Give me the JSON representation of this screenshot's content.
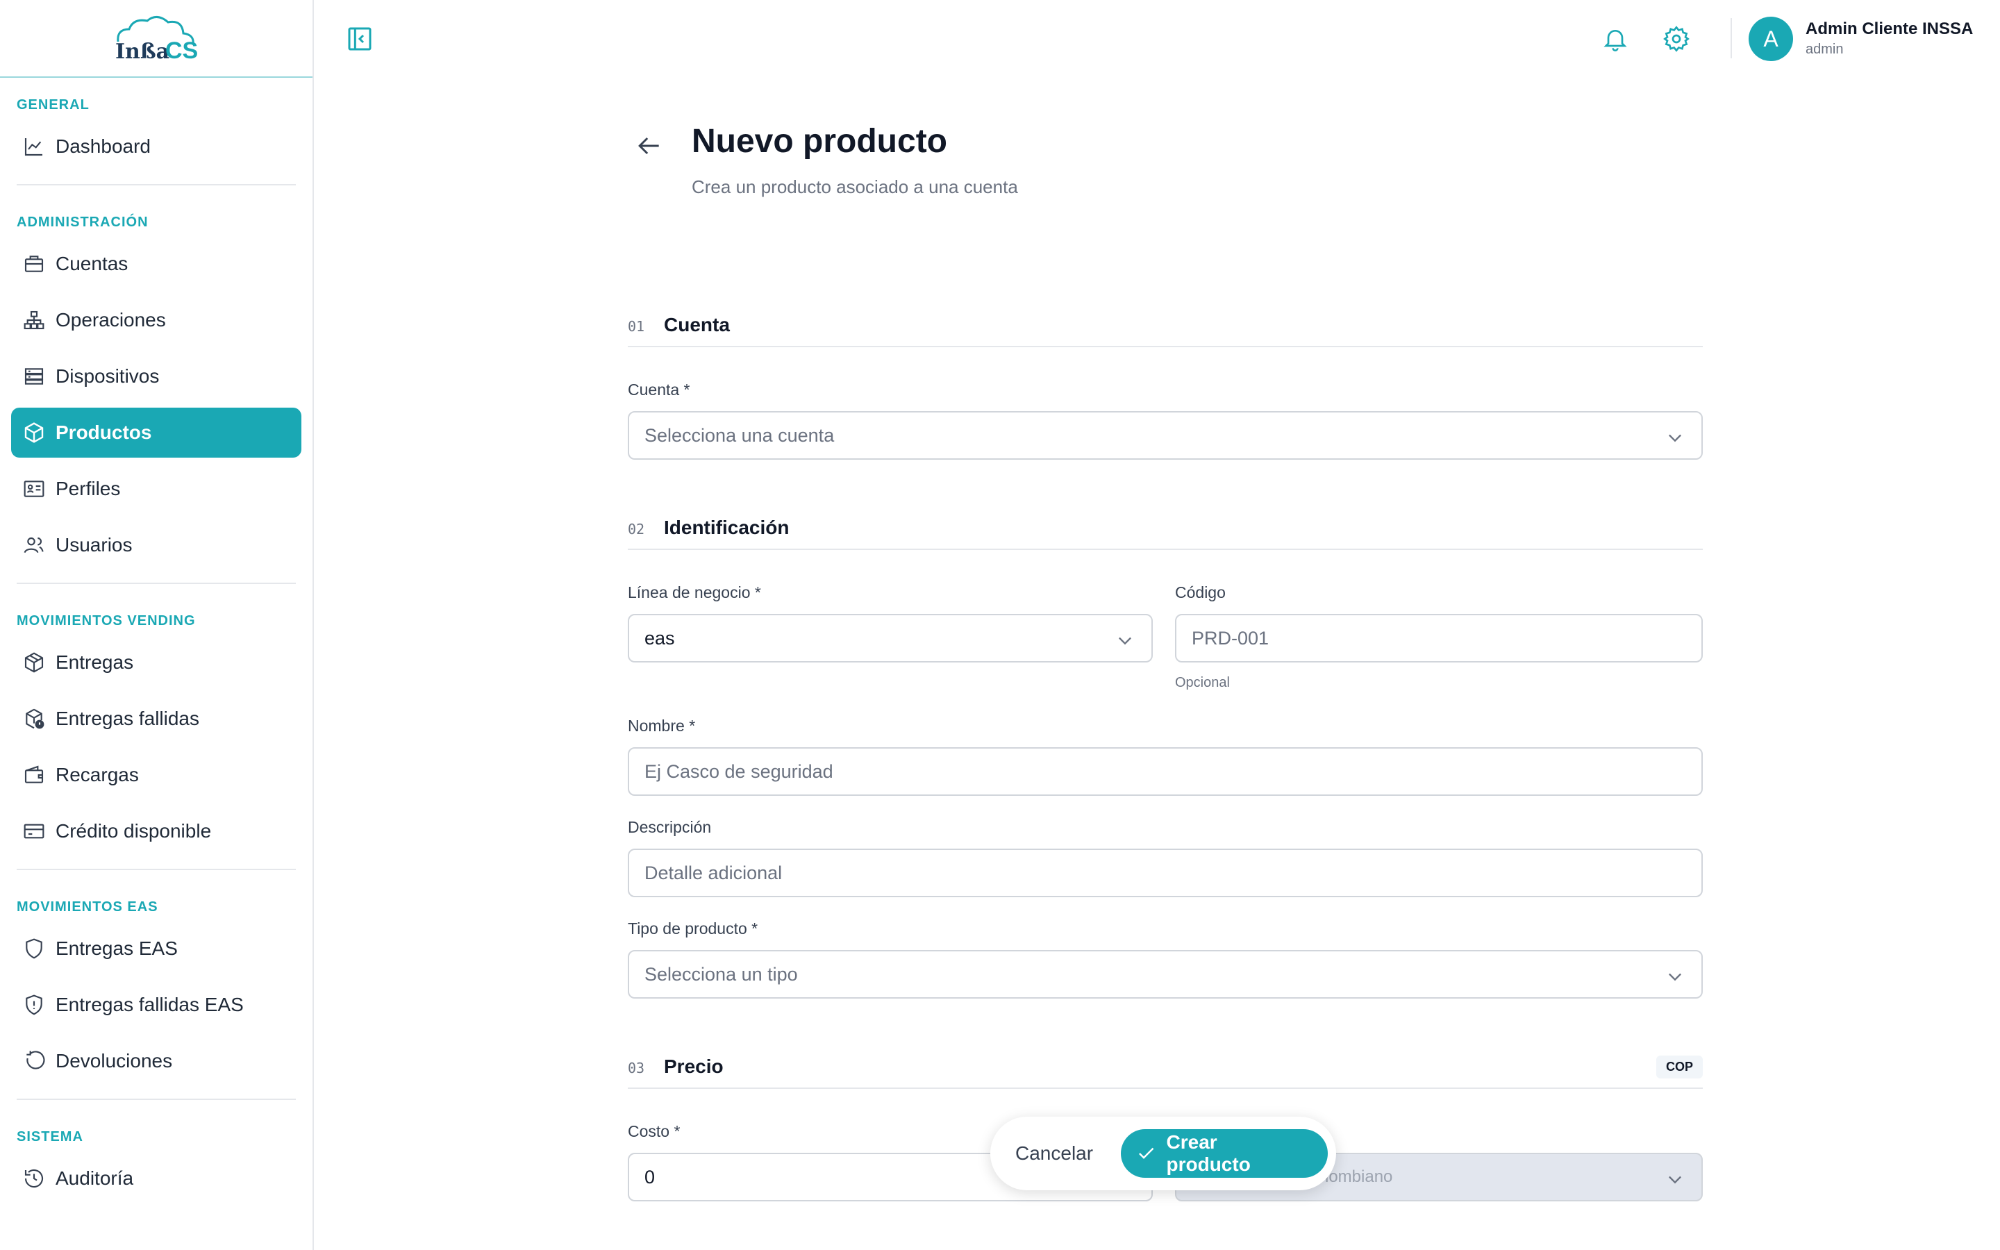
{
  "brand": {
    "logo_text": "Inssa CS",
    "accent": "#1aa8b4"
  },
  "sidebar": {
    "sections": [
      {
        "label": "GENERAL",
        "items": [
          {
            "label": "Dashboard",
            "icon": "chart-line-icon"
          }
        ]
      },
      {
        "label": "ADMINISTRACIÓN",
        "items": [
          {
            "label": "Cuentas",
            "icon": "briefcase-icon"
          },
          {
            "label": "Operaciones",
            "icon": "hierarchy-icon"
          },
          {
            "label": "Dispositivos",
            "icon": "server-icon"
          },
          {
            "label": "Productos",
            "icon": "box-icon",
            "active": true
          },
          {
            "label": "Perfiles",
            "icon": "id-card-icon"
          },
          {
            "label": "Usuarios",
            "icon": "users-icon"
          }
        ]
      },
      {
        "label": "MOVIMIENTOS VENDING",
        "items": [
          {
            "label": "Entregas",
            "icon": "package-icon"
          },
          {
            "label": "Entregas fallidas",
            "icon": "package-alert-icon"
          },
          {
            "label": "Recargas",
            "icon": "wallet-icon"
          },
          {
            "label": "Crédito disponible",
            "icon": "credit-card-icon"
          }
        ]
      },
      {
        "label": "MOVIMIENTOS EAS",
        "items": [
          {
            "label": "Entregas EAS",
            "icon": "shield-icon"
          },
          {
            "label": "Entregas fallidas EAS",
            "icon": "shield-alert-icon"
          },
          {
            "label": "Devoluciones",
            "icon": "undo-icon"
          }
        ]
      },
      {
        "label": "SISTEMA",
        "items": [
          {
            "label": "Auditoría",
            "icon": "history-icon"
          }
        ]
      }
    ]
  },
  "topbar": {
    "user": {
      "initial": "A",
      "name": "Admin Cliente INSSA",
      "role": "admin"
    }
  },
  "page": {
    "title": "Nuevo producto",
    "subtitle": "Crea un producto asociado a una cuenta"
  },
  "form": {
    "s1": {
      "num": "01",
      "title": "Cuenta"
    },
    "cuenta": {
      "label": "Cuenta *",
      "placeholder": "Selecciona una cuenta"
    },
    "s2": {
      "num": "02",
      "title": "Identificación"
    },
    "linea": {
      "label": "Línea de negocio *",
      "value": "eas"
    },
    "codigo": {
      "label": "Código",
      "placeholder": "PRD-001",
      "hint": "Opcional"
    },
    "nombre": {
      "label": "Nombre *",
      "placeholder": "Ej Casco de seguridad"
    },
    "descripcion": {
      "label": "Descripción",
      "placeholder": "Detalle adicional"
    },
    "tipo": {
      "label": "Tipo de producto *",
      "placeholder": "Selecciona un tipo"
    },
    "s3": {
      "num": "03",
      "title": "Precio",
      "badge": "COP"
    },
    "costo": {
      "label": "Costo *",
      "value": "0"
    },
    "moneda": {
      "value": "…lombiano"
    }
  },
  "actions": {
    "cancel": "Cancelar",
    "create": "Crear producto"
  }
}
